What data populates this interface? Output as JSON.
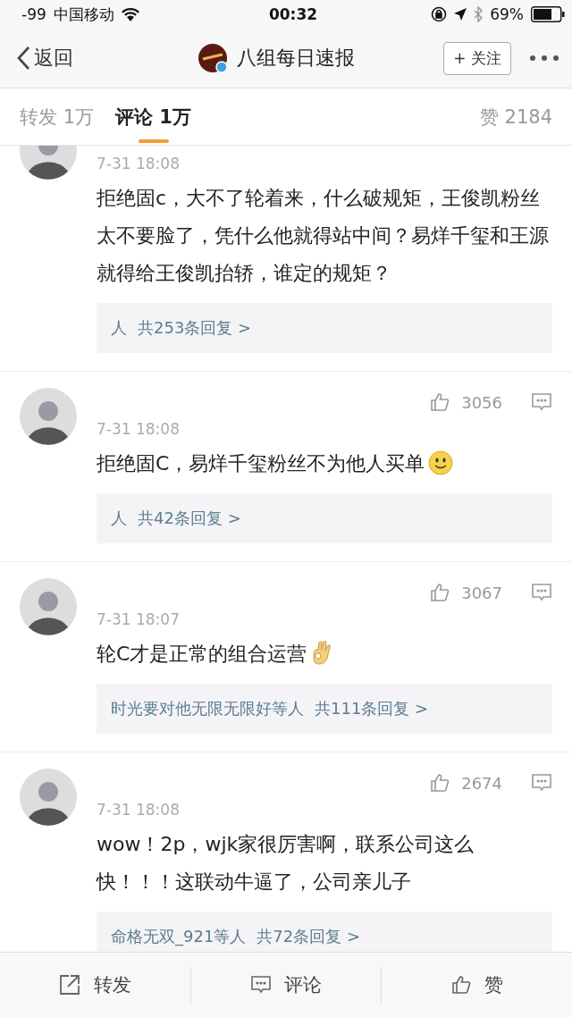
{
  "status_bar": {
    "signal": "-99",
    "carrier": "中国移动",
    "time": "00:32",
    "battery": "69%"
  },
  "nav": {
    "back": "返回",
    "title": "八组每日速报",
    "follow": "+ 关注"
  },
  "tabs": [
    {
      "label": "转发 1万",
      "selected": false
    },
    {
      "label": "评论 1万",
      "selected": true
    }
  ],
  "likes_tab": "赞 2184",
  "comments": [
    {
      "time": "7-31 18:08",
      "text": "拒绝固c，大不了轮着来，什么破规矩，王俊凯粉丝太不要脸了，凭什么他就得站中间？易烊千玺和王源就得给王俊凯抬轿，谁定的规矩？",
      "replies_by": "人",
      "replies": "共253条回复 >",
      "cut": true
    },
    {
      "likes": "3056",
      "time": "7-31 18:08",
      "text": "拒绝固C，易烊千玺粉丝不为他人买单",
      "kind": "smiley",
      "replies_by": "人",
      "replies": "共42条回复 >"
    },
    {
      "likes": "3067",
      "time": "7-31 18:07",
      "text": "轮C才是正常的组合运营",
      "kind": "ok-hand",
      "replies_by": "时光要对他无限无限好等人",
      "replies": "共111条回复 >"
    },
    {
      "likes": "2674",
      "time": "7-31 18:08",
      "text": "wow！2p，wjk家很厉害啊，联系公司这么快！！！这联动牛逼了，公司亲儿子",
      "replies_by": "命格无双_921等人",
      "replies": "共72条回复 >"
    }
  ],
  "bottom_bar": [
    {
      "kind": "share",
      "label": "转发"
    },
    {
      "kind": "comment",
      "label": "评论"
    },
    {
      "kind": "like",
      "label": "赞"
    }
  ]
}
